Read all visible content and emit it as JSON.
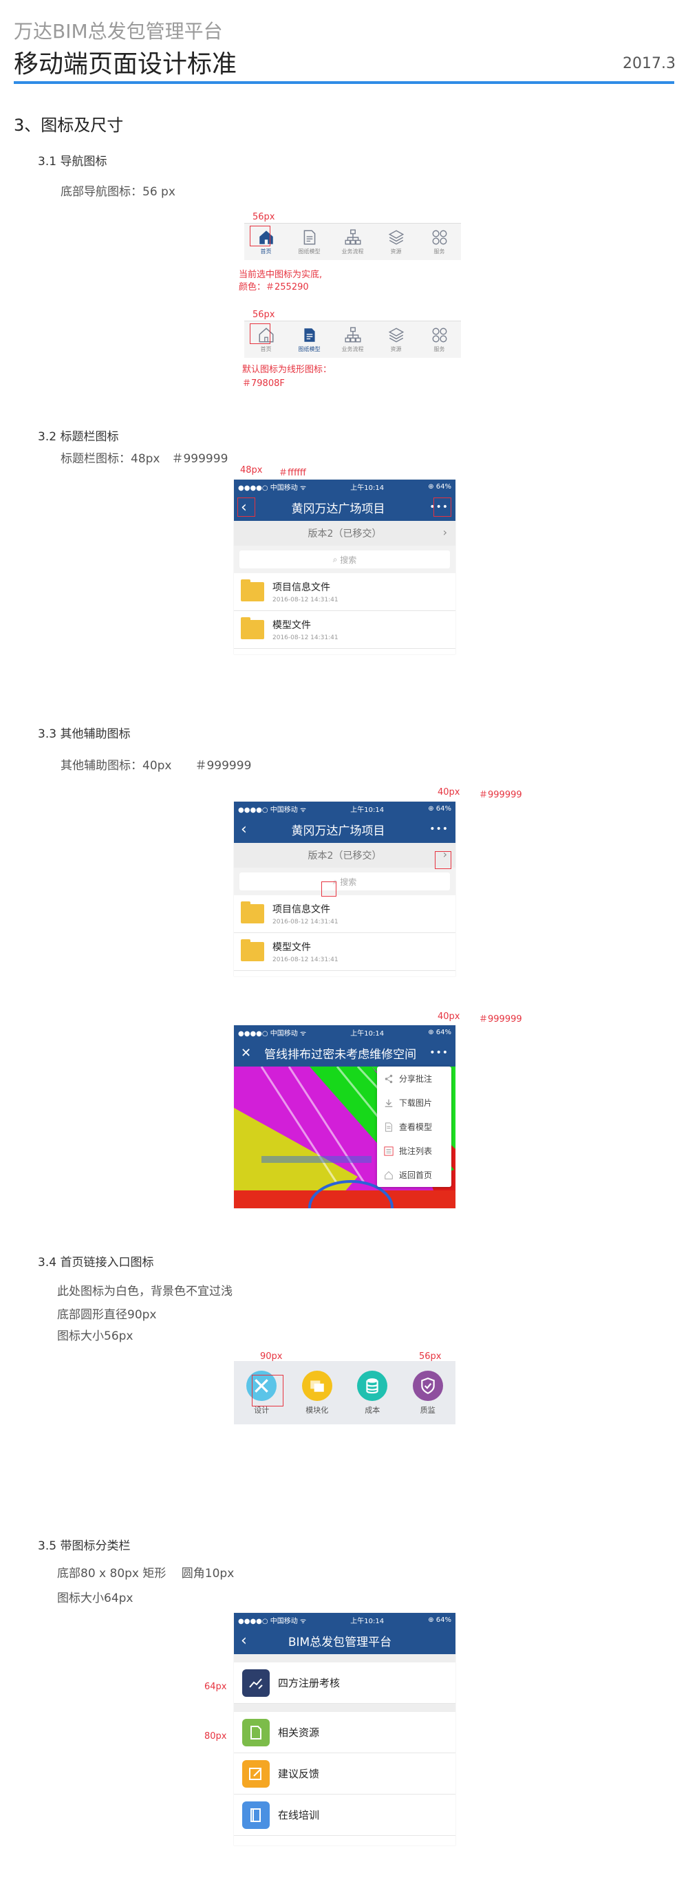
{
  "header": {
    "subtitle": "万达BIM总发包管理平台",
    "title": "移动端页面设计标准",
    "date": "2017.3"
  },
  "section": {
    "title": "3、图标及尺寸"
  },
  "s31": {
    "title": "3.1 导航图标",
    "desc": "底部导航图标：56 px",
    "size_label_1": "56px",
    "size_label_2": "56px",
    "note_solid_1": "当前选中图标为实底,",
    "note_solid_2": "颜色：＃255290",
    "note_line_1": "默认图标为线形图标：",
    "note_line_2": "＃79808F",
    "tabs": [
      "首页",
      "图纸模型",
      "业务流程",
      "资源",
      "服务"
    ],
    "active_color": "#255290",
    "default_color": "#79808F"
  },
  "s32": {
    "title": "3.2 标题栏图标",
    "desc": "标题栏图标：48px　＃999999",
    "size_label": "48px",
    "color_label": "＃ffffff"
  },
  "phone": {
    "carrier": "●●●●○ 中国移动 ᯤ",
    "time": "上午10:14",
    "battery": "⊕ 64%",
    "title": "黄冈万达广场项目",
    "version": "版本2（已移交）",
    "search": "搜索",
    "files": [
      {
        "name": "项目信息文件",
        "date": "2016-08-12 14:31:41"
      },
      {
        "name": "模型文件",
        "date": "2016-08-12 14:31:41"
      }
    ]
  },
  "s33": {
    "title": "3.3 其他辅助图标",
    "desc": "其他辅助图标：40px　　＃999999",
    "size_label_1": "40px",
    "color_label_1": "＃999999",
    "size_label_2": "40px",
    "color_label_2": "＃999999",
    "view_title": "管线排布过密未考虑维修空间",
    "menu": [
      "分享批注",
      "下载图片",
      "查看模型",
      "批注列表",
      "返回首页"
    ]
  },
  "s34": {
    "title": "3.4 首页链接入口图标",
    "line1": "此处图标为白色，背景色不宜过浅",
    "line2": "底部圆形直径90px",
    "line3": "图标大小56px",
    "size_label_1": "90px",
    "size_label_2": "56px",
    "icons": [
      {
        "label": "设计",
        "color": "#5bc4e8"
      },
      {
        "label": "模块化",
        "color": "#f5c11b"
      },
      {
        "label": "成本",
        "color": "#20c0b0"
      },
      {
        "label": "质监",
        "color": "#8e4f9e"
      }
    ]
  },
  "s35": {
    "title": "3.5 带图标分类栏",
    "line1": "底部80 x 80px 矩形　 圆角10px",
    "line2": "图标大小64px",
    "size_label_1": "64px",
    "size_label_2": "80px",
    "app_title": "BIM总发包管理平台",
    "items": [
      {
        "label": "四方注册考核",
        "color": "#2c3e6b"
      },
      {
        "label": "相关资源",
        "color": "#7cbc4a"
      },
      {
        "label": "建议反馈",
        "color": "#f5a623"
      },
      {
        "label": "在线培训",
        "color": "#4a90e2"
      }
    ]
  }
}
